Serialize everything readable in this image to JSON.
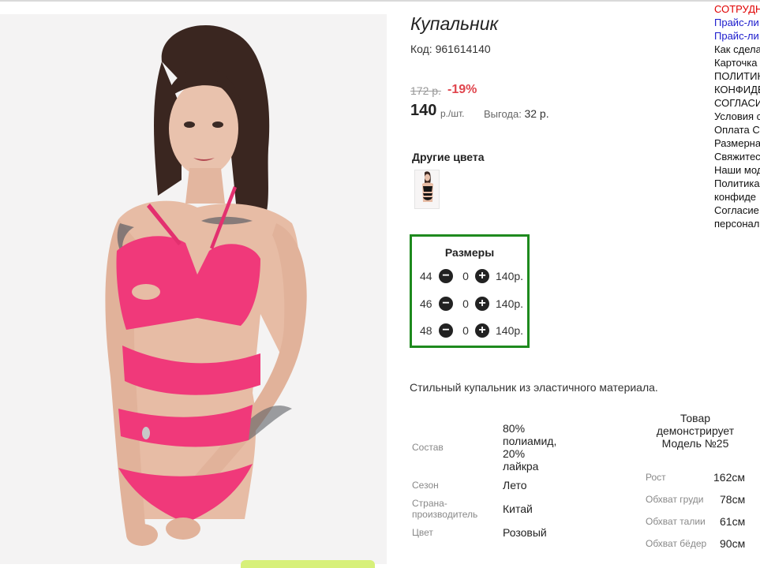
{
  "product": {
    "title": "Купальник",
    "code": "Код: 961614140",
    "old_price": "172 р.",
    "discount": "-19%",
    "price": "140",
    "price_unit": "р./шт.",
    "benefit_label": "Выгода:",
    "benefit_value": "32 р."
  },
  "other_colors": {
    "heading": "Другие цвета"
  },
  "sizes": {
    "heading": "Размеры",
    "rows": [
      {
        "size": "44",
        "qty": "0",
        "price": "140р."
      },
      {
        "size": "46",
        "qty": "0",
        "price": "140р."
      },
      {
        "size": "48",
        "qty": "0",
        "price": "140р."
      }
    ],
    "minus_icon": "−",
    "plus_icon": "+"
  },
  "description": "Стильный купальник из эластичного материала.",
  "specs": [
    {
      "label": "Состав",
      "value": "80%\nполиамид,\n20%\nлайкра"
    },
    {
      "label": "Сезон",
      "value": "Лето"
    },
    {
      "label": "Страна-\nпроизводитель",
      "value": "Китай"
    },
    {
      "label": "Цвет",
      "value": "Розовый"
    }
  ],
  "model": {
    "heading": "Товар\nдемонстрирует\nМодель №25",
    "measurements": [
      {
        "label": "Рост",
        "value": "162см"
      },
      {
        "label": "Обхват груди",
        "value": "78см"
      },
      {
        "label": "Обхват талии",
        "value": "61см"
      },
      {
        "label": "Обхват бёдер",
        "value": "90см"
      }
    ]
  },
  "side_links": [
    {
      "text": "СОТРУДН",
      "color": "#e00000"
    },
    {
      "text": "Прайс-ли",
      "color": "#1a1acc"
    },
    {
      "text": "Прайс-ли",
      "color": "#1a1acc"
    },
    {
      "text": "Как сдела",
      "color": "#111111"
    },
    {
      "text": "Карточка",
      "color": "#111111"
    },
    {
      "text": "ПОЛИТИК",
      "color": "#111111"
    },
    {
      "text": "КОНФИДЕ",
      "color": "#111111"
    },
    {
      "text": "СОГЛАСИ",
      "color": "#111111"
    },
    {
      "text": "Условия с",
      "color": "#111111"
    },
    {
      "text": "Оплата С",
      "color": "#111111"
    },
    {
      "text": "Размерна",
      "color": "#111111"
    },
    {
      "text": "Свяжитес",
      "color": "#111111"
    },
    {
      "text": "Наши мод",
      "color": "#111111"
    },
    {
      "text": "Политика",
      "color": "#111111"
    },
    {
      "text": "конфиде",
      "color": "#111111"
    },
    {
      "text": "Согласие",
      "color": "#111111"
    },
    {
      "text": "персонал",
      "color": "#111111"
    }
  ],
  "colors": {
    "accent_green": "#1e8a1e",
    "discount_red": "#e0454d",
    "swimsuit_pink": "#f0397a"
  }
}
